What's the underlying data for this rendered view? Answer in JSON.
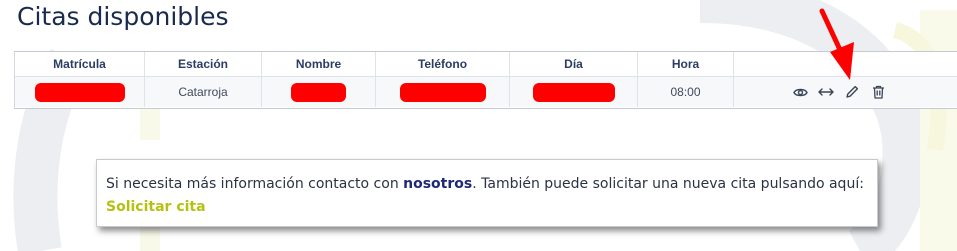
{
  "page": {
    "title": "Citas disponibles"
  },
  "table": {
    "headers": [
      "Matrícula",
      "Estación",
      "Nombre",
      "Teléfono",
      "Día",
      "Hora"
    ],
    "rows": [
      {
        "matricula": "",
        "estacion": "Catarroja",
        "nombre": "",
        "telefono": "",
        "dia": "",
        "hora": "08:00"
      }
    ],
    "row_actions": [
      "eye-icon",
      "arrows-horizontal-icon",
      "pencil-icon",
      "trash-icon"
    ]
  },
  "info": {
    "text_before": "Si necesita más información contacto con ",
    "contact_link": "nosotros",
    "text_middle": ". También puede solicitar una nueva cita pulsando aquí: ",
    "cta_link": "Solicitar cita"
  },
  "colors": {
    "title": "#1a2a4d",
    "header_text": "#2b3d63",
    "redaction": "#ff0000",
    "link_dark": "#1e2a78",
    "link_accent": "#b5c011",
    "annotation_arrow": "#ff0000"
  }
}
